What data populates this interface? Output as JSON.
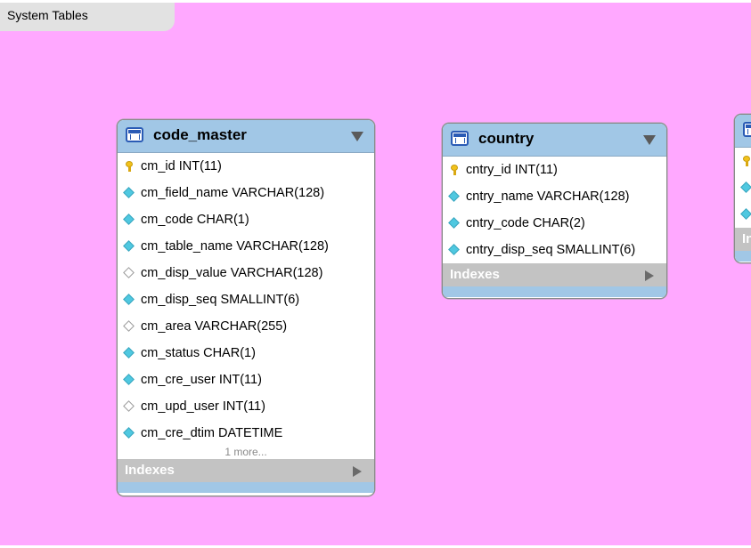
{
  "layer": {
    "title": "System Tables"
  },
  "tables": [
    {
      "name": "code_master",
      "columns": [
        {
          "icon": "primary-key-icon",
          "text": "cm_id INT(11)"
        },
        {
          "icon": "filled-diamond-icon",
          "text": "cm_field_name VARCHAR(128)"
        },
        {
          "icon": "filled-diamond-icon",
          "text": "cm_code CHAR(1)"
        },
        {
          "icon": "filled-diamond-icon",
          "text": "cm_table_name VARCHAR(128)"
        },
        {
          "icon": "empty-diamond-icon",
          "text": "cm_disp_value VARCHAR(128)"
        },
        {
          "icon": "filled-diamond-icon",
          "text": "cm_disp_seq SMALLINT(6)"
        },
        {
          "icon": "empty-diamond-icon",
          "text": "cm_area VARCHAR(255)"
        },
        {
          "icon": "filled-diamond-icon",
          "text": "cm_status CHAR(1)"
        },
        {
          "icon": "filled-diamond-icon",
          "text": "cm_cre_user INT(11)"
        },
        {
          "icon": "empty-diamond-icon",
          "text": "cm_upd_user INT(11)"
        },
        {
          "icon": "filled-diamond-icon",
          "text": "cm_cre_dtim DATETIME"
        }
      ],
      "more_label": "1 more...",
      "indexes_label": "Indexes"
    },
    {
      "name": "country",
      "columns": [
        {
          "icon": "primary-key-icon",
          "text": "cntry_id INT(11)"
        },
        {
          "icon": "filled-diamond-icon",
          "text": "cntry_name VARCHAR(128)"
        },
        {
          "icon": "filled-diamond-icon",
          "text": "cntry_code CHAR(2)"
        },
        {
          "icon": "filled-diamond-icon",
          "text": "cntry_disp_seq SMALLINT(6)"
        }
      ],
      "indexes_label": "Indexes"
    },
    {
      "name": "",
      "columns": [
        {
          "icon": "primary-key-icon",
          "text": ""
        },
        {
          "icon": "filled-diamond-icon",
          "text": ""
        },
        {
          "icon": "filled-diamond-icon",
          "text": ""
        }
      ],
      "indexes_label": "In"
    }
  ]
}
